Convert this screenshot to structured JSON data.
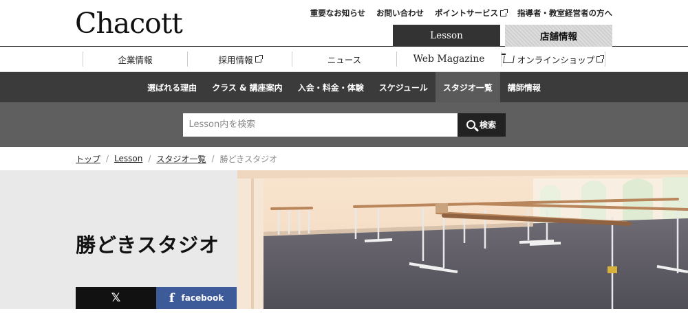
{
  "header": {
    "logo": "Chacott",
    "top_links": [
      {
        "label": "重要なお知らせ",
        "external": false
      },
      {
        "label": "お問い合わせ",
        "external": false
      },
      {
        "label": "ポイントサービス",
        "external": true
      },
      {
        "label": "指導者・教室経営者の方へ",
        "external": false
      }
    ],
    "tabs": {
      "lesson": "Lesson",
      "store": "店舗情報"
    }
  },
  "subnav": [
    {
      "label": "企業情報",
      "external": false
    },
    {
      "label": "採用情報",
      "external": true
    },
    {
      "label": "ニュース",
      "external": false
    },
    {
      "label": "Web Magazine",
      "external": false
    },
    {
      "label": "オンラインショップ",
      "external": true,
      "icon": "cart-icon"
    }
  ],
  "menu": {
    "items": [
      "選ばれる理由",
      "クラス & 講座案内",
      "入会・料金・体験",
      "スケジュール",
      "スタジオ一覧",
      "講師情報"
    ],
    "active": "スタジオ一覧"
  },
  "search": {
    "placeholder": "Lesson内を検索",
    "button": "検索"
  },
  "breadcrumb": {
    "items": [
      "トップ",
      "Lesson",
      "スタジオ一覧"
    ],
    "current": "勝どきスタジオ"
  },
  "hero": {
    "title": "勝どきスタジオ"
  },
  "share": {
    "x": "𝕏",
    "facebook": "facebook",
    "facebook_icon": "f"
  },
  "colors": {
    "dark_menu": "#3b3b3b",
    "search_band": "#5f5f5f",
    "facebook": "#3d5a99"
  }
}
